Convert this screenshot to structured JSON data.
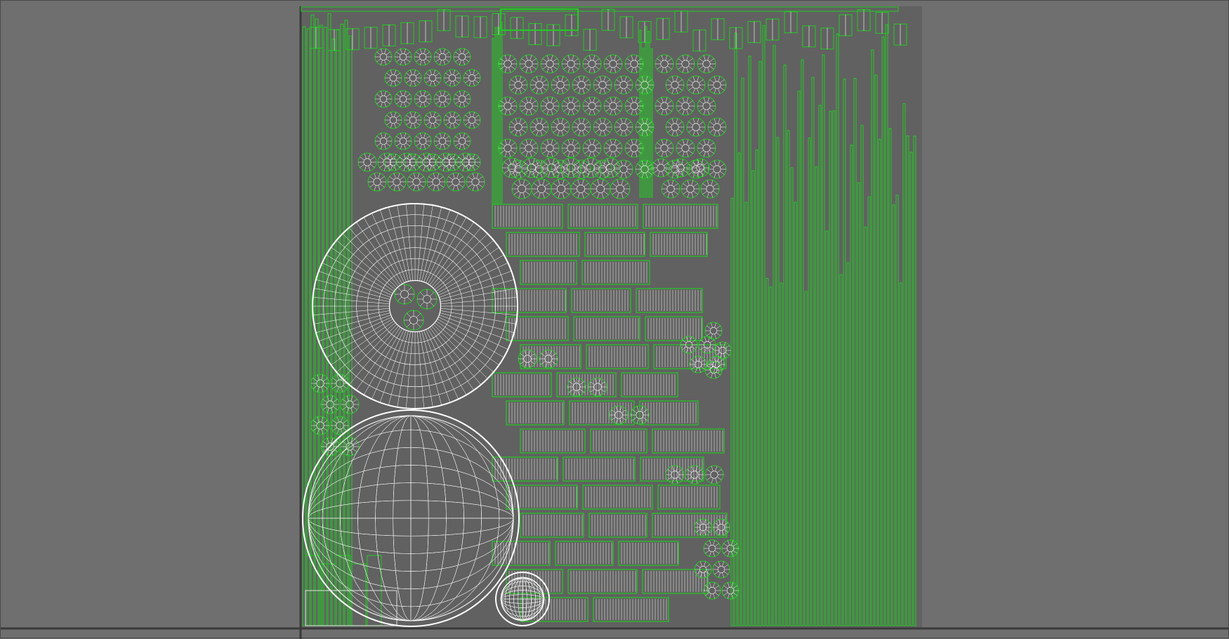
{
  "app": {
    "window": "uv-editor-viewport"
  },
  "colors": {
    "background": "#6f6f6f",
    "uv_tile_fill": "#616161",
    "uv_edge_green": "#22cc22",
    "uv_wire_white": "#ffffff",
    "frame_dark": "#3a3a3a"
  },
  "icons": []
}
